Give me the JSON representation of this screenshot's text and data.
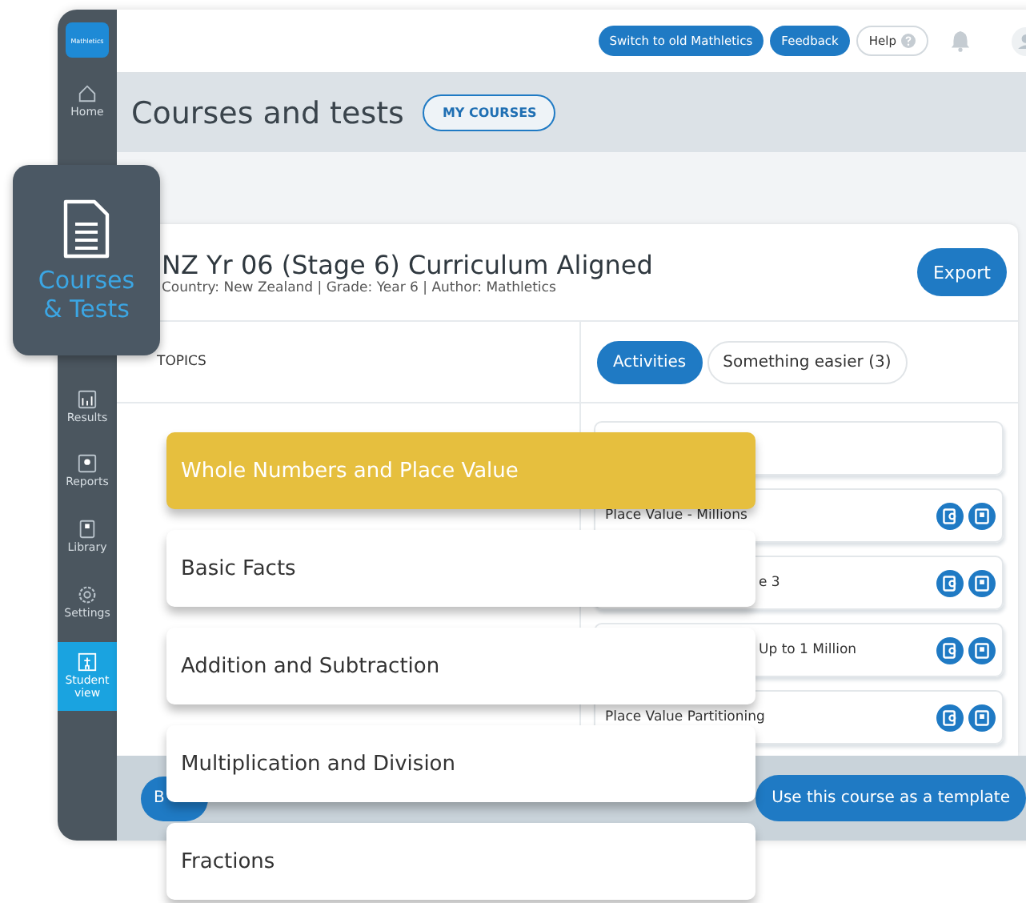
{
  "logo": {
    "text": "Mathletics"
  },
  "top_bar": {
    "buttons": [
      {
        "label": "Switch to old Mathletics",
        "kind": "filled"
      },
      {
        "label": "Feedback",
        "kind": "filled"
      },
      {
        "label": "Help",
        "kind": "outline"
      }
    ]
  },
  "sidebar": {
    "items": [
      {
        "label": "Home",
        "selected": false
      },
      {
        "label": "Results",
        "selected": false
      },
      {
        "label": "Reports",
        "selected": false
      },
      {
        "label": "Library",
        "selected": false
      },
      {
        "label": "Settings",
        "selected": false
      },
      {
        "label": "Student view",
        "selected": true
      }
    ]
  },
  "header": {
    "title": "Courses and tests",
    "button": "MY COURSES"
  },
  "course": {
    "title": "NZ Yr 06 (Stage 6) Curriculum Aligned",
    "meta": "Country: New Zealand | Grade: Year 6 | Author: Mathletics",
    "export": "Export"
  },
  "topics_heading": "TOPICS",
  "tabs": [
    {
      "label": "Activities",
      "selected": true
    },
    {
      "label": "Something easier (3)",
      "selected": false
    }
  ],
  "activities": [
    {
      "kind": "empty"
    },
    {
      "kind": "full",
      "name": "Place Value - Millions"
    },
    {
      "kind": "partial",
      "name": "e 3"
    },
    {
      "kind": "partial",
      "name": "Up to 1 Million"
    },
    {
      "kind": "full",
      "name": "Place Value Partitioning"
    }
  ],
  "footer": {
    "back": "B",
    "template": "Use this course as a template"
  },
  "callout": {
    "label": "Courses & Tests"
  },
  "topics": [
    {
      "label": "Whole Numbers and Place Value",
      "selected": true
    },
    {
      "label": "Basic Facts",
      "selected": false
    },
    {
      "label": "Addition and Subtraction",
      "selected": false
    },
    {
      "label": "Multiplication and Division",
      "selected": false
    },
    {
      "label": "Fractions",
      "selected": false
    }
  ]
}
